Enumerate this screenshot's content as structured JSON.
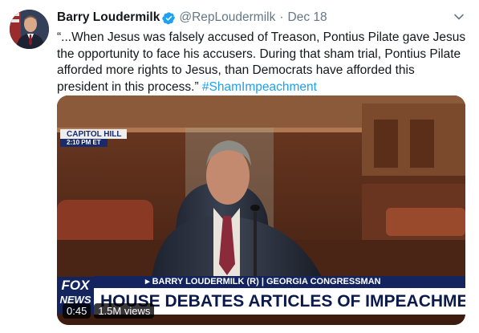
{
  "tweet": {
    "display_name": "Barry Loudermilk",
    "handle": "@RepLoudermilk",
    "separator": "·",
    "date": "Dec 18",
    "text_lines": [
      "“...When Jesus was falsely accused of Treason, Pontius Pilate gave Jesus",
      "the opportunity to face his accusers. During that sham trial, Pontius Pilate",
      "afforded more rights to Jesus, than Democrats have afforded this"
    ],
    "text_last": "president in this process.”",
    "hashtag": "#ShamImpeachment"
  },
  "icons": {
    "verified": "verified-badge-icon",
    "caret": "chevron-down-icon"
  },
  "colors": {
    "link": "#1da1f2",
    "secondary_text": "#657786",
    "chyron_navy": "#13245e"
  },
  "video": {
    "location_tag": "CAPITOL HILL",
    "time_tag": "2:10 PM ET",
    "chyron_name": "▸ BARRY LOUDERMILK (R) | GEORGIA CONGRESSMAN",
    "chyron_headline": "HOUSE DEBATES ARTICLES OF IMPEACHMEN",
    "network_logo_top": "FOX",
    "network_logo_bottom": "NEWS",
    "duration": "0:45",
    "views": "1.5M views"
  }
}
